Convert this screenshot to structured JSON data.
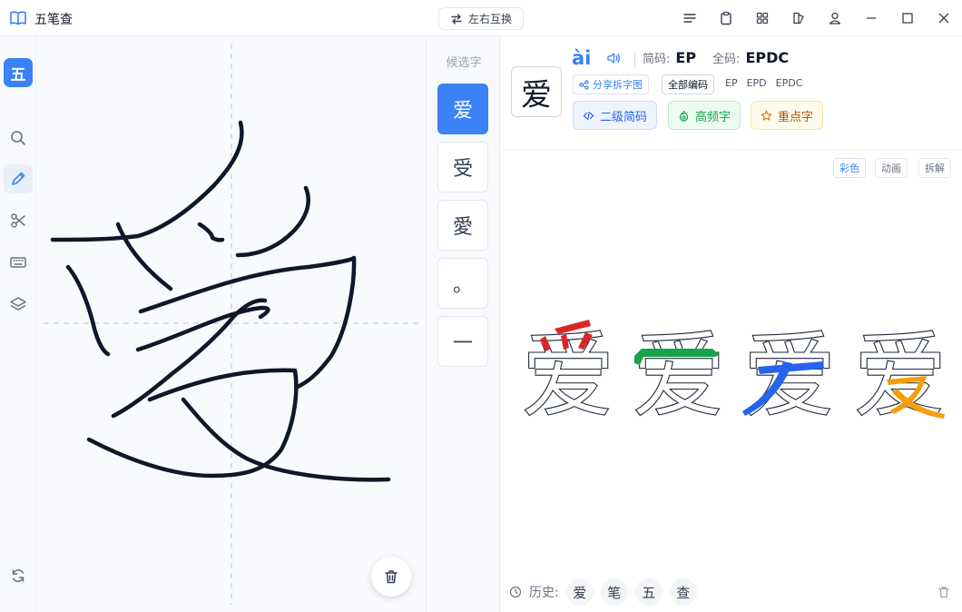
{
  "app": {
    "title": "五笔查"
  },
  "toolbar": {
    "swap_label": "左右互换"
  },
  "sidebar": {
    "logo": "五"
  },
  "candidates": {
    "label": "候选字",
    "items": [
      "爱",
      "受",
      "愛",
      "。",
      "一"
    ],
    "selected_index": 0
  },
  "detail": {
    "character": "爱",
    "pinyin": "ài",
    "short_code_label": "简码:",
    "short_code": "EP",
    "full_code_label": "全码:",
    "full_code": "EPDC",
    "share_label": "分享拆字图",
    "all_codes_label": "全部编码",
    "codes": [
      "EP",
      "EPD",
      "EPDC"
    ],
    "tags": [
      "二级简码",
      "高频字",
      "重点字"
    ],
    "modes": [
      "彩色",
      "动画",
      "拆解"
    ],
    "history_label": "历史:",
    "history": [
      "爱",
      "笔",
      "五",
      "查"
    ]
  },
  "colors": {
    "accent": "#3b82f6",
    "ink": "#0f172a",
    "part_red": "#dc2626",
    "part_green": "#16a34a",
    "part_blue": "#2563eb",
    "part_orange": "#f59e0b"
  }
}
